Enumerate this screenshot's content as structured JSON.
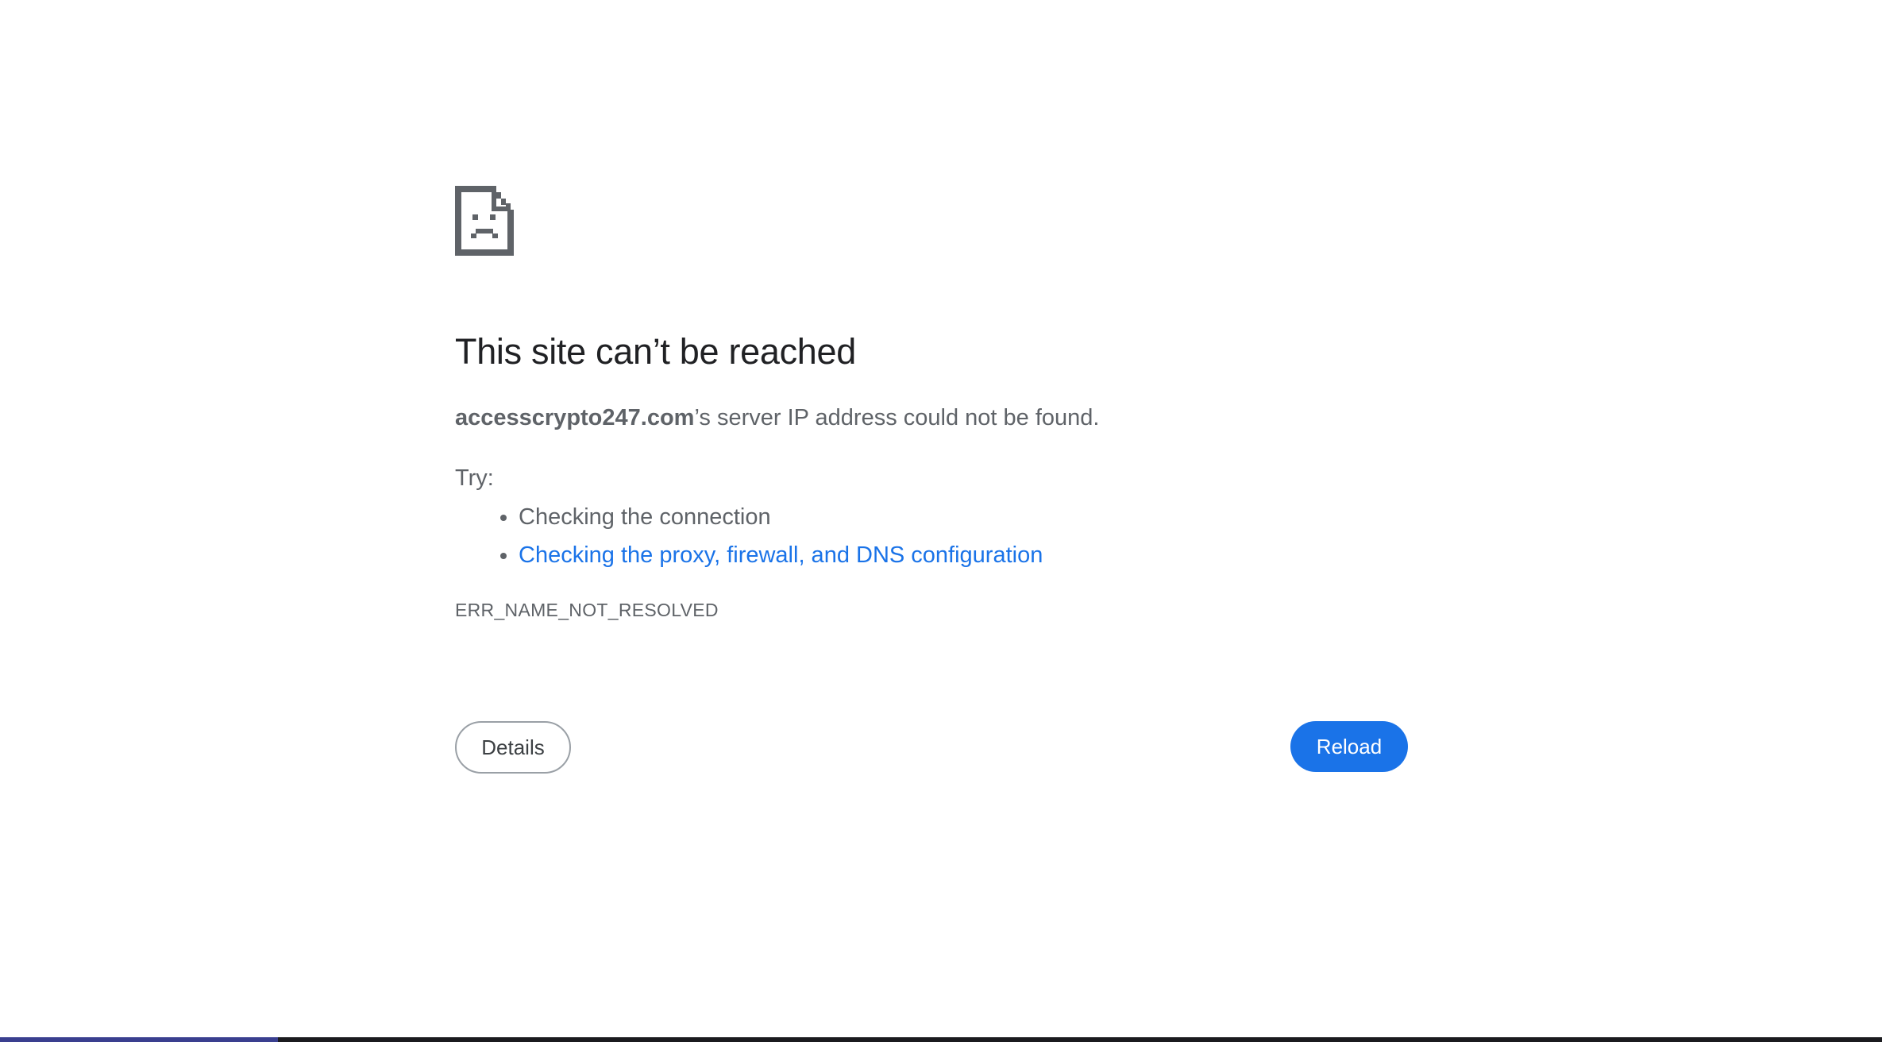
{
  "error": {
    "icon": "sad-file-icon",
    "headline": "This site can’t be reached",
    "host": "accesscrypto247.com",
    "summary_suffix": "’s server IP address could not be found.",
    "try_label": "Try:",
    "suggestions": [
      "Checking the connection",
      "Checking the proxy, firewall, and DNS configuration"
    ],
    "code": "ERR_NAME_NOT_RESOLVED"
  },
  "buttons": {
    "details_label": "Details",
    "reload_label": "Reload"
  },
  "colors": {
    "link": "#1a73e8",
    "reload_bg": "#1a73e8",
    "headline": "#202124",
    "body_text": "#5f6368"
  }
}
